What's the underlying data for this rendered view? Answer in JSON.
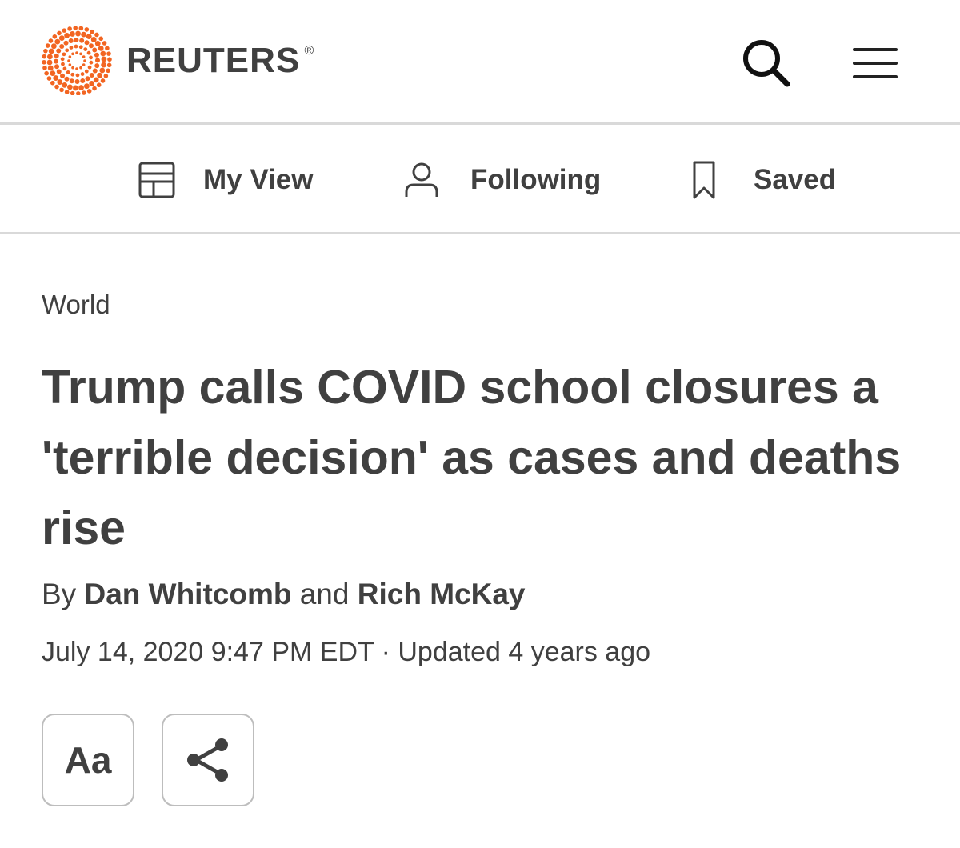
{
  "header": {
    "logo_text": "REUTERS",
    "logo_mark": "®",
    "brand_color": "#f26522",
    "search_icon": "search-icon",
    "menu_icon": "hamburger-menu-icon"
  },
  "subnav": {
    "items": [
      {
        "label": "My View",
        "icon": "layout-icon"
      },
      {
        "label": "Following",
        "icon": "person-icon"
      },
      {
        "label": "Saved",
        "icon": "bookmark-icon"
      }
    ]
  },
  "article": {
    "section": "World",
    "headline": "Trump calls COVID school closures a 'terrible decision' as cases and deaths rise",
    "byline": {
      "prefix": "By ",
      "author1": "Dan Whitcomb",
      "joiner": " and ",
      "author2": "Rich McKay"
    },
    "dateline": "July 14, 2020 9:47 PM EDT · Updated 4 years ago"
  },
  "tools": {
    "text_size_label": "Aa",
    "share_icon": "share-icon"
  },
  "colors": {
    "text": "#404040",
    "divider": "#d9d9d9",
    "button_border": "#bdbdbd"
  }
}
